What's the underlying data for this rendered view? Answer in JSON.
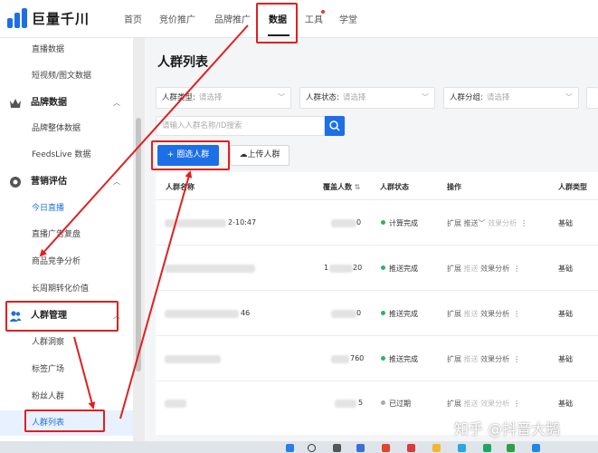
{
  "app": {
    "logo_text": "巨量千川"
  },
  "nav": {
    "home": "首页",
    "bidding": "竞价推广",
    "brand": "品牌推广",
    "data": "数据",
    "tools": "工具",
    "learn": "学堂"
  },
  "sidebar": {
    "items_top": [
      "直播数据",
      "短视频/图文数据"
    ],
    "group_brand": "品牌数据",
    "brand_items": [
      "品牌整体数据",
      "FeedsLive 数据"
    ],
    "group_marketing": "营销评估",
    "marketing_items": [
      "今日直播",
      "直播广告复盘",
      "商品竞争分析",
      "长周期转化价值"
    ],
    "group_audience": "人群管理",
    "audience_items": [
      "人群洞察",
      "标签广场",
      "粉丝人群",
      "人群列表"
    ]
  },
  "page": {
    "title": "人群列表",
    "filters": [
      {
        "label": "人群类型:",
        "placeholder": "请选择"
      },
      {
        "label": "人群状态:",
        "placeholder": "请选择"
      },
      {
        "label": "人群分组:",
        "placeholder": "请选择"
      }
    ],
    "search_placeholder": "请输入人群名称/ID搜索",
    "select_button": "圈选人群",
    "upload_button": "上传人群"
  },
  "table": {
    "headers": {
      "name": "人群名称",
      "coverage": "覆盖人数",
      "status": "人群状态",
      "ops": "操作",
      "type": "人群类型"
    },
    "rows": [
      {
        "name_visible": "2-10:47",
        "coverage_visible": "0",
        "status": "计算完成",
        "status_color": "#2db55d",
        "ops": [
          "扩展",
          "推送",
          "效果分析"
        ],
        "type": "基础"
      },
      {
        "name_visible": "",
        "coverage_visible": "1",
        "coverage_suffix": "20",
        "status": "推送完成",
        "status_color": "#2db55d",
        "ops": [
          "扩展",
          "推送",
          "效果分析"
        ],
        "type": "基础"
      },
      {
        "name_visible": "46",
        "coverage_visible": "0",
        "status": "推送完成",
        "status_color": "#2db55d",
        "ops": [
          "扩展",
          "推送",
          "效果分析"
        ],
        "type": "基础"
      },
      {
        "name_visible": "",
        "coverage_visible": "760",
        "status": "推送完成",
        "status_color": "#2db55d",
        "ops": [
          "扩展",
          "推送",
          "效果分析"
        ],
        "type": "基础"
      },
      {
        "name_visible": "",
        "coverage_visible": "5",
        "status": "已过期",
        "status_color": "#aaaaaa",
        "ops": [
          "扩展",
          "推送",
          "效果分析"
        ],
        "type": "基础"
      }
    ]
  },
  "watermark": "知乎 @抖音大鹅",
  "colors": {
    "accent": "#1d6fe8",
    "annotation": "#e21f1f"
  }
}
